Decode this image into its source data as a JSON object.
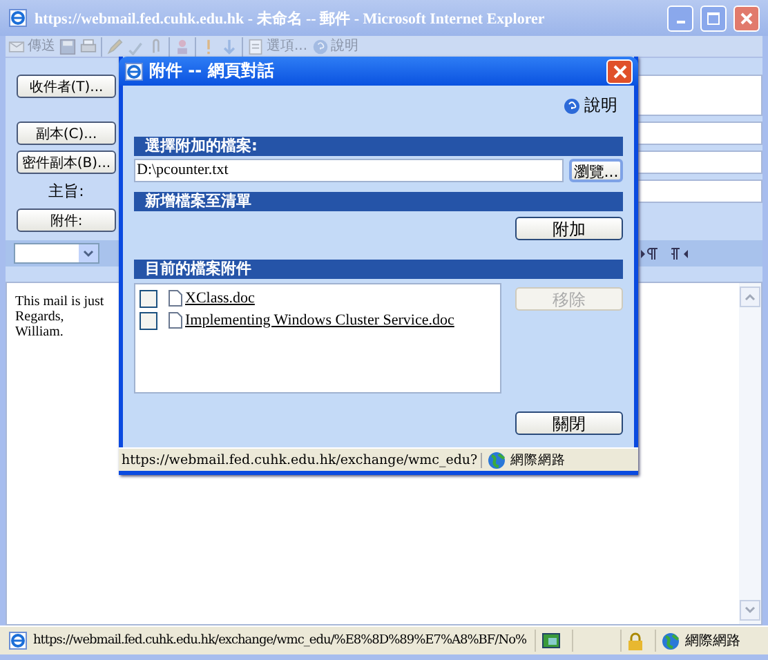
{
  "window": {
    "title": "https://webmail.fed.cuhk.edu.hk - 未命名 -- 郵件 - Microsoft Internet Explorer"
  },
  "toolbar": [
    {
      "kind": "send",
      "label": "傳送"
    },
    {
      "kind": "save"
    },
    {
      "kind": "print"
    },
    {
      "kind": "sep"
    },
    {
      "kind": "edit"
    },
    {
      "kind": "spell"
    },
    {
      "kind": "clip"
    },
    {
      "kind": "sep"
    },
    {
      "kind": "people"
    },
    {
      "kind": "sep"
    },
    {
      "kind": "high"
    },
    {
      "kind": "low"
    },
    {
      "kind": "sep"
    },
    {
      "kind": "options",
      "label": "選項..."
    },
    {
      "kind": "help",
      "label": "說明"
    }
  ],
  "header_rows": [
    {
      "kind": "button",
      "label": "收件者(T)...",
      "tall": true
    },
    {
      "kind": "button",
      "label": "副本(C)..."
    },
    {
      "kind": "button",
      "label": "密件副本(B)..."
    },
    {
      "kind": "label",
      "label": "主旨:"
    },
    {
      "kind": "button",
      "label": "附件:"
    }
  ],
  "body_lines": [
    "This mail is just",
    "Regards,",
    "William."
  ],
  "status_bar": {
    "url": "https://webmail.fed.cuhk.edu.hk/exchange/wmc_edu/%E8%8D%89%E7%A8%BF/No%",
    "zone": "網際網路"
  },
  "dialog": {
    "title": "附件 -- 網頁對話",
    "help": "說明",
    "select_header": "選擇附加的檔案:",
    "file_value": "D:\\pcounter.txt",
    "browse": "瀏覽...",
    "add_header": "新增檔案至清單",
    "add": "附加",
    "current_header": "目前的檔案附件",
    "files": [
      {
        "name": "XClass.doc",
        "checked": false
      },
      {
        "name": "Implementing Windows Cluster Service.doc",
        "checked": false
      }
    ],
    "remove": {
      "label": "移除",
      "disabled": true
    },
    "close": "關閉",
    "status_bar": {
      "url": "https://webmail.fed.cuhk.edu.hk/exchange/wmc_edu?",
      "zone": "網際網路"
    }
  }
}
